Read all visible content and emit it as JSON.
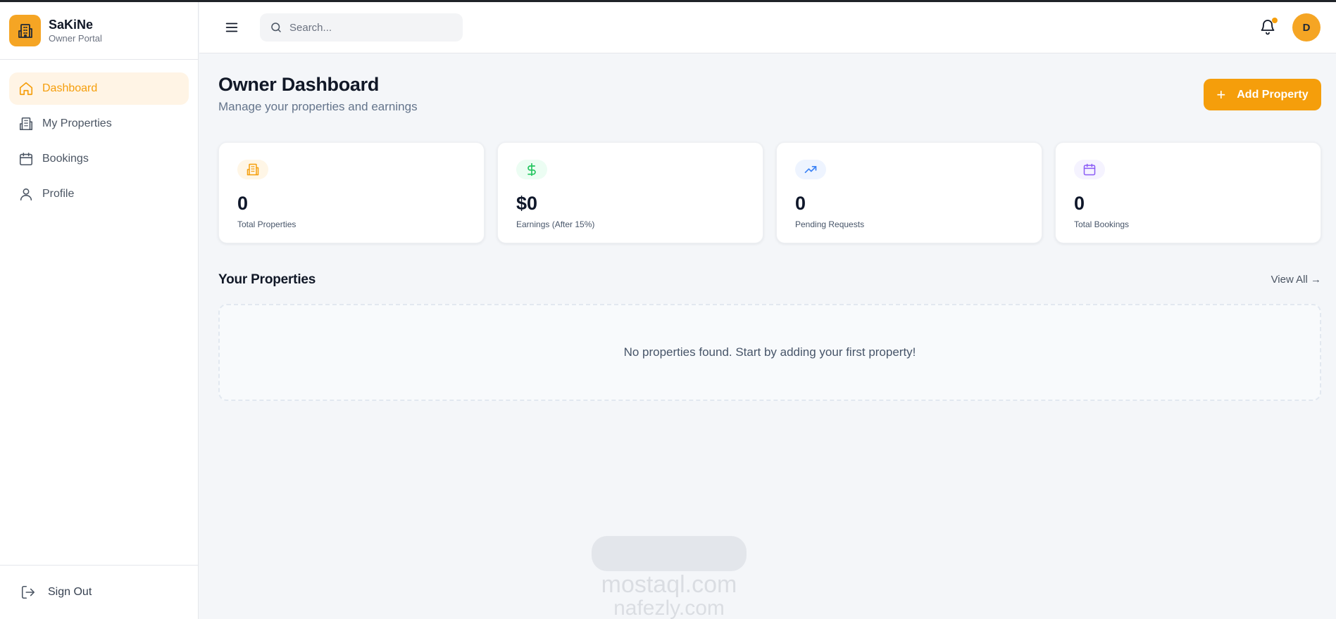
{
  "brand": {
    "name": "SaKiNe",
    "subtitle": "Owner Portal"
  },
  "sidebar": {
    "items": [
      {
        "label": "Dashboard",
        "icon": "home-icon",
        "active": true
      },
      {
        "label": "My Properties",
        "icon": "building-icon",
        "active": false
      },
      {
        "label": "Bookings",
        "icon": "calendar-icon",
        "active": false
      },
      {
        "label": "Profile",
        "icon": "user-icon",
        "active": false
      }
    ],
    "sign_out": "Sign Out"
  },
  "header": {
    "search_placeholder": "Search...",
    "avatar_initial": "D",
    "has_notification": true
  },
  "page": {
    "title": "Owner Dashboard",
    "subtitle": "Manage your properties and earnings",
    "add_button": "Add Property"
  },
  "stats": [
    {
      "value": "0",
      "label": "Total Properties",
      "icon": "building-icon",
      "color": "#f59e0b"
    },
    {
      "value": "$0",
      "label": "Earnings (After 15%)",
      "icon": "dollar-icon",
      "color": "#22c55e"
    },
    {
      "value": "0",
      "label": "Pending Requests",
      "icon": "trending-up-icon",
      "color": "#3b82f6"
    },
    {
      "value": "0",
      "label": "Total Bookings",
      "icon": "calendar-icon",
      "color": "#8b5cf6"
    }
  ],
  "properties": {
    "title": "Your Properties",
    "view_all": "View All →",
    "empty_message": "No properties found. Start by adding your first property!"
  },
  "watermark": {
    "line1": "mostaql.com",
    "line2": "nafezly.com"
  },
  "colors": {
    "accent": "#f59e0b",
    "accent_bg": "#fff4e5",
    "page_bg": "#f4f6f9"
  }
}
